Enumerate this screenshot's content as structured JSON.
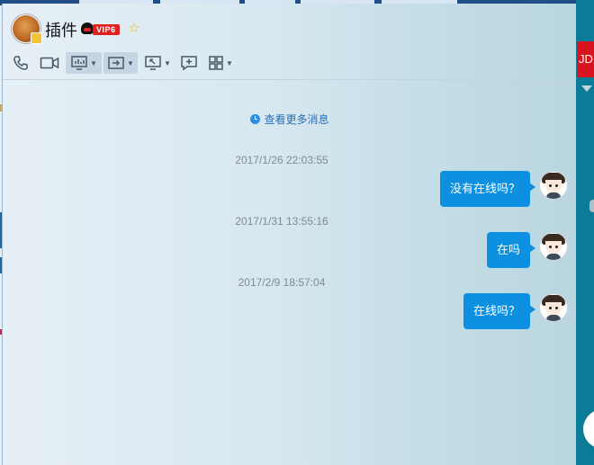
{
  "window": {
    "title": "插件",
    "vip_label": "VIP6"
  },
  "toolbar": {
    "items": [
      {
        "name": "voice-call",
        "icon": "phone-icon"
      },
      {
        "name": "video-call",
        "icon": "video-camera-icon"
      },
      {
        "name": "remote-demo",
        "icon": "chart-screen-icon"
      },
      {
        "name": "file-transfer",
        "icon": "transfer-icon"
      },
      {
        "name": "remote-desktop",
        "icon": "monitor-icon"
      },
      {
        "name": "discussion",
        "icon": "add-chat-icon"
      },
      {
        "name": "apps",
        "icon": "apps-grid-icon"
      }
    ]
  },
  "history": {
    "more_label": "查看更多消息"
  },
  "messages": [
    {
      "time": "2017/1/26 22:03:55",
      "text": "没有在线吗？"
    },
    {
      "time": "2017/1/31 13:55:16",
      "text": "在吗"
    },
    {
      "time": "2017/2/9 18:57:04",
      "text": "在线吗？"
    }
  ],
  "side_panel": {
    "label": "JD"
  },
  "colors": {
    "bubble": "#0d90e0",
    "side_panel": "#0b7c97",
    "link": "#2a6fb8"
  }
}
